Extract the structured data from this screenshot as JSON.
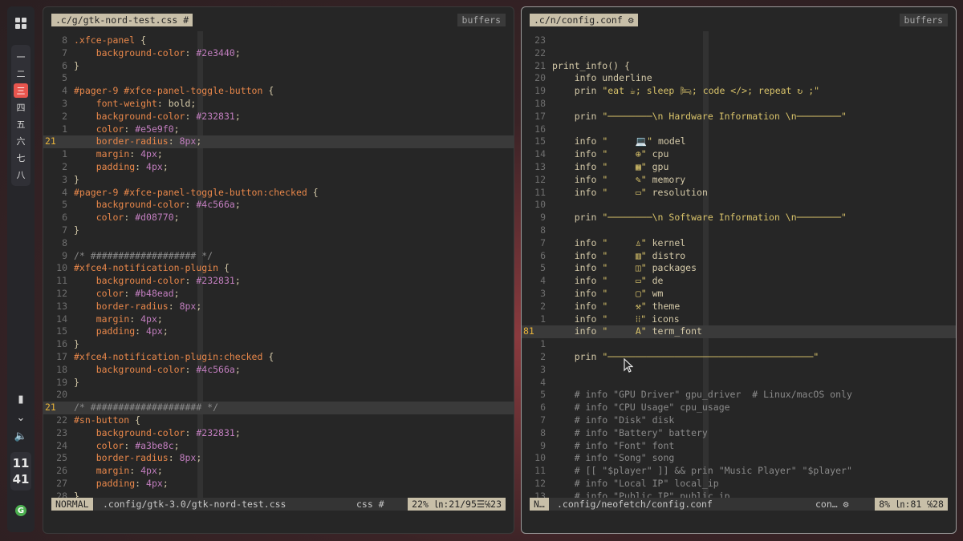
{
  "workspaces": [
    "一",
    "二",
    "三",
    "四",
    "五",
    "六",
    "七",
    "八"
  ],
  "active_workspace": 2,
  "clock": {
    "hour": "11",
    "minute": "41"
  },
  "left": {
    "tab": ".c/g/gtk-nord-test.css #",
    "buffers": "buffers",
    "cursor_line": 21,
    "lines": [
      {
        "n": "8",
        "t": ".xfce-panel {"
      },
      {
        "n": "7",
        "t": "    background-color: #2e3440;"
      },
      {
        "n": "6",
        "t": "}"
      },
      {
        "n": "5",
        "t": ""
      },
      {
        "n": "4",
        "t": "#pager-9 #xfce-panel-toggle-button {"
      },
      {
        "n": "3",
        "t": "    font-weight: bold;"
      },
      {
        "n": "2",
        "t": "    background-color: #232831;"
      },
      {
        "n": "1",
        "t": "    color: #e5e9f0;"
      },
      {
        "n": "21",
        "t": "    border-radius: 8px;"
      },
      {
        "n": "1",
        "t": "    margin: 4px;"
      },
      {
        "n": "2",
        "t": "    padding: 4px;"
      },
      {
        "n": "3",
        "t": "}"
      },
      {
        "n": "4",
        "t": "#pager-9 #xfce-panel-toggle-button:checked {"
      },
      {
        "n": "5",
        "t": "    background-color: #4c566a;"
      },
      {
        "n": "6",
        "t": "    color: #d08770;"
      },
      {
        "n": "7",
        "t": "}"
      },
      {
        "n": "8",
        "t": ""
      },
      {
        "n": "9",
        "t": "/* ################### */"
      },
      {
        "n": "10",
        "t": "#xfce4-notification-plugin {"
      },
      {
        "n": "11",
        "t": "    background-color: #232831;"
      },
      {
        "n": "12",
        "t": "    color: #b48ead;"
      },
      {
        "n": "13",
        "t": "    border-radius: 8px;"
      },
      {
        "n": "14",
        "t": "    margin: 4px;"
      },
      {
        "n": "15",
        "t": "    padding: 4px;"
      },
      {
        "n": "16",
        "t": "}"
      },
      {
        "n": "17",
        "t": "#xfce4-notification-plugin:checked {"
      },
      {
        "n": "18",
        "t": "    background-color: #4c566a;"
      },
      {
        "n": "19",
        "t": "}"
      },
      {
        "n": "20",
        "t": ""
      },
      {
        "n": "21",
        "t": "/* #################### */"
      },
      {
        "n": "22",
        "t": "#sn-button {"
      },
      {
        "n": "23",
        "t": "    background-color: #232831;"
      },
      {
        "n": "24",
        "t": "    color: #a3be8c;"
      },
      {
        "n": "25",
        "t": "    border-radius: 8px;"
      },
      {
        "n": "26",
        "t": "    margin: 4px;"
      },
      {
        "n": "27",
        "t": "    padding: 4px;"
      },
      {
        "n": "28",
        "t": "}"
      }
    ],
    "status": {
      "mode": "NORMAL",
      "path": ".config/gtk-3.0/gtk-nord-test.css",
      "ft": "css #",
      "pos": "22% ㏑:21/95☰℅23"
    }
  },
  "right": {
    "tab": ".c/n/config.conf ⚙",
    "buffers": "buffers",
    "cursor_line": 81,
    "lines": [
      {
        "n": "23",
        "t": ""
      },
      {
        "n": "22",
        "t": ""
      },
      {
        "n": "21",
        "t": "print_info() {"
      },
      {
        "n": "20",
        "t": "    info underline"
      },
      {
        "n": "19",
        "t": "    prin \"eat ☕; sleep 🛏; code </>; repeat ↻ ;\""
      },
      {
        "n": "18",
        "t": ""
      },
      {
        "n": "17",
        "t": "    prin \"────────\\n Hardware Information \\n────────\""
      },
      {
        "n": "16",
        "t": ""
      },
      {
        "n": "15",
        "t": "    info \"     💻\" model"
      },
      {
        "n": "14",
        "t": "    info \"     ⊕\" cpu"
      },
      {
        "n": "13",
        "t": "    info \"     ▦\" gpu"
      },
      {
        "n": "12",
        "t": "    info \"     ✎\" memory"
      },
      {
        "n": "11",
        "t": "    info \"     ▭\" resolution"
      },
      {
        "n": "10",
        "t": ""
      },
      {
        "n": "9",
        "t": "    prin \"────────\\n Software Information \\n────────\""
      },
      {
        "n": "8",
        "t": ""
      },
      {
        "n": "7",
        "t": "    info \"     ♙\" kernel"
      },
      {
        "n": "6",
        "t": "    info \"     ▥\" distro"
      },
      {
        "n": "5",
        "t": "    info \"     ◫\" packages"
      },
      {
        "n": "4",
        "t": "    info \"     ▭\" de"
      },
      {
        "n": "3",
        "t": "    info \"     ▢\" wm"
      },
      {
        "n": "2",
        "t": "    info \"     ⚒\" theme"
      },
      {
        "n": "1",
        "t": "    info \"     ⁞⁞\" icons"
      },
      {
        "n": "81",
        "t": "    info \"     A\" term_font"
      },
      {
        "n": "1",
        "t": ""
      },
      {
        "n": "2",
        "t": "    prin \"─────────────────────────────────────\""
      },
      {
        "n": "3",
        "t": ""
      },
      {
        "n": "4",
        "t": ""
      },
      {
        "n": "5",
        "t": "    # info \"GPU Driver\" gpu_driver  # Linux/macOS only"
      },
      {
        "n": "6",
        "t": "    # info \"CPU Usage\" cpu_usage"
      },
      {
        "n": "7",
        "t": "    # info \"Disk\" disk"
      },
      {
        "n": "8",
        "t": "    # info \"Battery\" battery"
      },
      {
        "n": "9",
        "t": "    # info \"Font\" font"
      },
      {
        "n": "10",
        "t": "    # info \"Song\" song"
      },
      {
        "n": "11",
        "t": "    # [[ \"$player\" ]] && prin \"Music Player\" \"$player\""
      },
      {
        "n": "12",
        "t": "    # info \"Local IP\" local_ip"
      },
      {
        "n": "13",
        "t": "    # info \"Public IP\" public_ip"
      }
    ],
    "status": {
      "mode": "N…",
      "path": ".config/neofetch/config.conf",
      "ft": "con… ⚙",
      "pos": "8% ㏑:81 ℅28"
    }
  }
}
